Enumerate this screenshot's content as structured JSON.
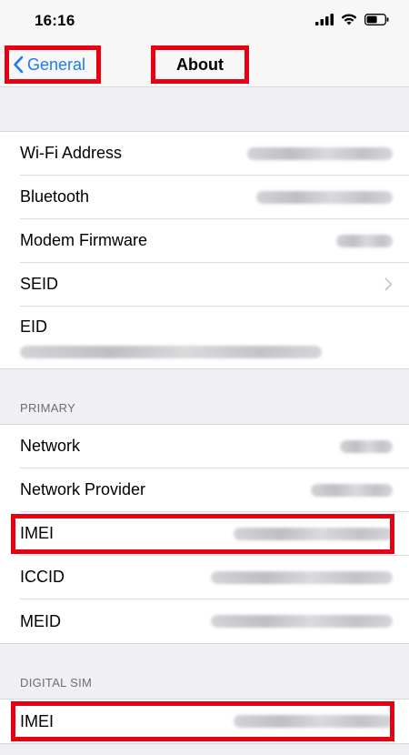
{
  "status": {
    "time": "16:16"
  },
  "nav": {
    "back_label": "General",
    "title": "About"
  },
  "rows_main": [
    {
      "label": "Wi-Fi Address"
    },
    {
      "label": "Bluetooth"
    },
    {
      "label": "Modem Firmware"
    },
    {
      "label": "SEID"
    },
    {
      "label": "EID"
    }
  ],
  "primary": {
    "header": "PRIMARY",
    "rows": [
      {
        "label": "Network"
      },
      {
        "label": "Network Provider"
      },
      {
        "label": "IMEI"
      },
      {
        "label": "ICCID"
      },
      {
        "label": "MEID"
      }
    ]
  },
  "digital_sim": {
    "header": "DIGITAL SIM",
    "rows": [
      {
        "label": "IMEI"
      }
    ]
  },
  "colors": {
    "accent": "#1a7cf5",
    "highlight": "#e60012"
  }
}
